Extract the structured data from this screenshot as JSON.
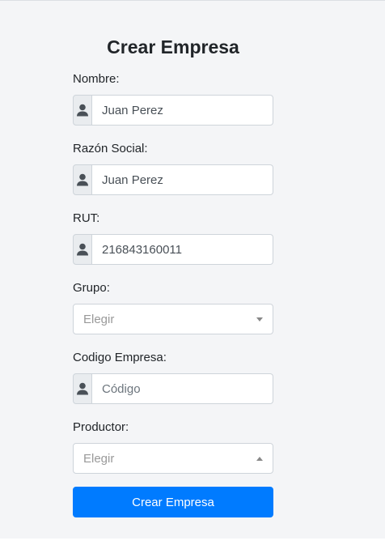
{
  "form": {
    "title": "Crear Empresa",
    "nombre": {
      "label": "Nombre:",
      "value": "Juan Perez",
      "icon": "user-icon"
    },
    "razon_social": {
      "label": "Razón Social:",
      "value": "Juan Perez",
      "icon": "user-icon"
    },
    "rut": {
      "label": "RUT:",
      "value": "216843160011",
      "icon": "user-icon"
    },
    "grupo": {
      "label": "Grupo:",
      "placeholder": "Elegir",
      "caret": "chevron-down-icon"
    },
    "codigo_empresa": {
      "label": "Codigo Empresa:",
      "value": "",
      "placeholder": "Código",
      "icon": "user-icon"
    },
    "productor": {
      "label": "Productor:",
      "placeholder": "Elegir",
      "caret": "chevron-up-icon"
    },
    "submit_label": "Crear Empresa"
  },
  "colors": {
    "primary": "#007bff",
    "panel_bg": "#f4f5f7",
    "addon_bg": "#e9ecef",
    "icon": "#495057"
  }
}
